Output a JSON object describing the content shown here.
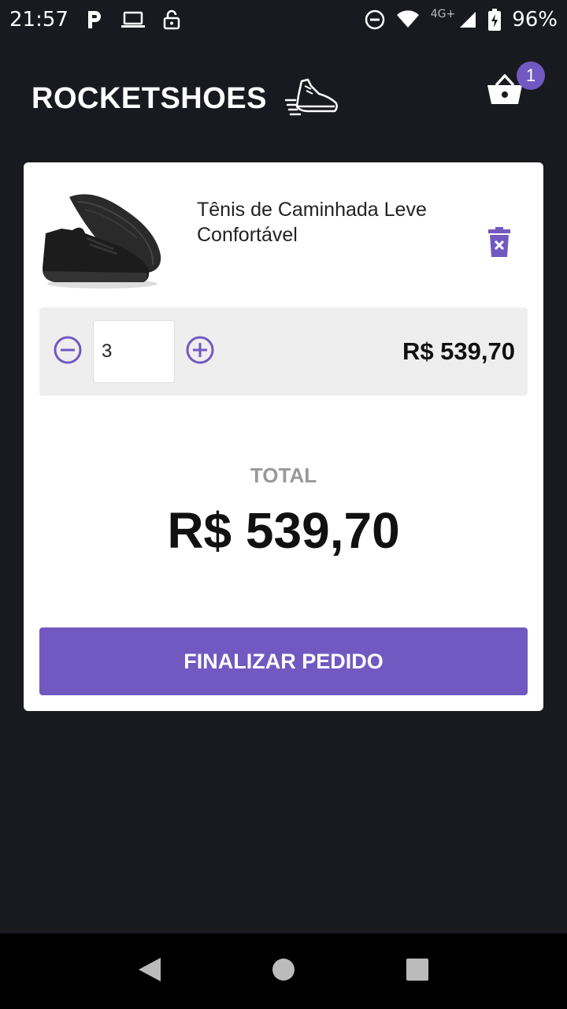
{
  "status_bar": {
    "time": "21:57",
    "network": "4G+",
    "battery": "96%",
    "icons": [
      "parking-icon",
      "laptop-icon",
      "lock-open-icon",
      "do-not-disturb-icon",
      "wifi-icon",
      "signal-icon",
      "battery-icon"
    ]
  },
  "header": {
    "brand": "ROCKETSHOES",
    "logo_icon": "running-shoe-icon",
    "cart_icon": "basket-icon",
    "cart_count": "1"
  },
  "cart": {
    "item": {
      "title": "Tênis de Caminhada Leve Confortável",
      "image_icon": "sneaker-image",
      "quantity": "3",
      "subtotal": "R$ 539,70",
      "delete_icon": "trash-icon",
      "minus_icon": "minus-circle-icon",
      "plus_icon": "plus-circle-icon"
    },
    "total_label": "TOTAL",
    "total_value": "R$ 539,70",
    "checkout_label": "FINALIZAR PEDIDO"
  },
  "colors": {
    "background": "#191920",
    "accent": "#7159c1",
    "card": "#ffffff",
    "qty_row": "#eeeeee"
  },
  "nav_bar": {
    "icons": [
      "back-icon",
      "home-icon",
      "recents-icon"
    ]
  }
}
